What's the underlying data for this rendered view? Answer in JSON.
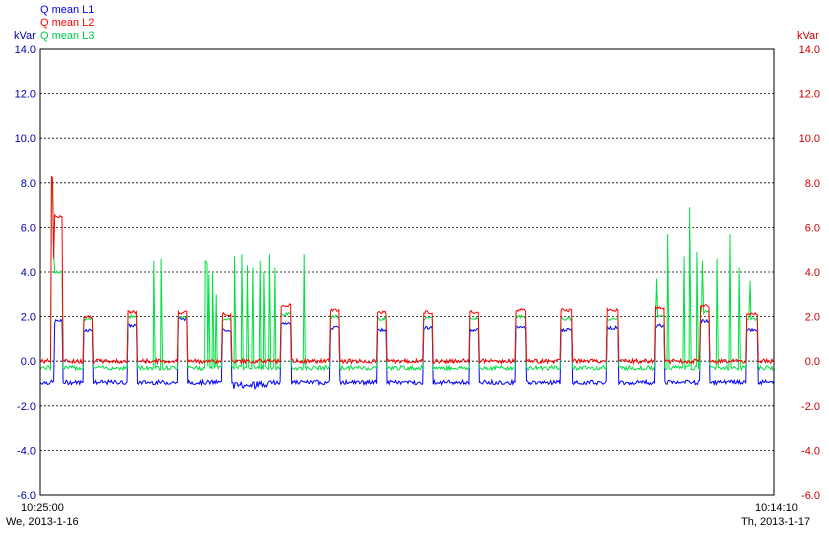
{
  "chart_data": {
    "type": "line",
    "legend": [
      {
        "name": "Q mean L1",
        "color": "#0000ff"
      },
      {
        "name": "Q mean L2",
        "color": "#ff0000"
      },
      {
        "name": "Q mean L3",
        "color": "#00e040"
      }
    ],
    "y_unit_left": "kVar",
    "y_unit_right": "kVar",
    "ylim": [
      -6.0,
      14.0
    ],
    "y_ticks": [
      "14.0",
      "12.0",
      "10.0",
      "8.0",
      "6.0",
      "4.0",
      "2.0",
      "0.0",
      "-2.0",
      "-4.0",
      "-6.0"
    ],
    "grid": "horizontal dashed",
    "x_start": {
      "time": "10:25:00",
      "date": "We, 2013-1-16"
    },
    "x_end": {
      "time": "10:14:10",
      "date": "Th, 2013-1-17"
    },
    "series_profile": {
      "L1": {
        "base": -0.95,
        "high": 1.4
      },
      "L2": {
        "base": 0.0,
        "high": 2.1
      },
      "L3": {
        "base": -0.3,
        "high": 1.9
      }
    },
    "pulses": [
      {
        "start": 0.04,
        "end": 0.06,
        "L1": 1.8,
        "L2": 6.5,
        "L3": 4.0
      },
      {
        "start": 0.12,
        "end": 0.145,
        "L1": 1.4,
        "L2": 2.0,
        "L3": 1.9
      },
      {
        "start": 0.24,
        "end": 0.265,
        "L1": 1.6,
        "L2": 2.2,
        "L3": 2.0
      },
      {
        "start": 0.375,
        "end": 0.4,
        "L1": 1.9,
        "L2": 2.2,
        "L3": 2.0
      },
      {
        "start": 0.495,
        "end": 0.52,
        "L1": 1.4,
        "L2": 2.1,
        "L3": 1.9
      },
      {
        "start": 0.655,
        "end": 0.685,
        "L1": 1.7,
        "L2": 2.5,
        "L3": 2.1
      },
      {
        "start": 0.79,
        "end": 0.815,
        "L1": 1.5,
        "L2": 2.3,
        "L3": 2.0
      },
      {
        "start": 0.92,
        "end": 0.945,
        "L1": 1.4,
        "L2": 2.2,
        "L3": 1.9
      },
      {
        "start": 1.045,
        "end": 1.07,
        "L1": 1.5,
        "L2": 2.2,
        "L3": 1.9
      },
      {
        "start": 1.17,
        "end": 1.195,
        "L1": 1.4,
        "L2": 2.2,
        "L3": 1.9
      },
      {
        "start": 1.295,
        "end": 1.325,
        "L1": 1.5,
        "L2": 2.3,
        "L3": 2.0
      },
      {
        "start": 1.42,
        "end": 1.45,
        "L1": 1.4,
        "L2": 2.3,
        "L3": 1.9
      },
      {
        "start": 1.545,
        "end": 1.575,
        "L1": 1.5,
        "L2": 2.3,
        "L3": 1.9
      },
      {
        "start": 1.675,
        "end": 1.7,
        "L1": 1.6,
        "L2": 2.4,
        "L3": 2.0
      },
      {
        "start": 1.8,
        "end": 1.825,
        "L1": 1.8,
        "L2": 2.5,
        "L3": 2.2
      },
      {
        "start": 1.925,
        "end": 1.955,
        "L1": 1.4,
        "L2": 2.1,
        "L3": 1.9
      }
    ],
    "spikes": [
      {
        "x": 0.03,
        "L3": 4.2,
        "L2": 4.4
      },
      {
        "x": 0.031,
        "L3": 8.0,
        "L2": 8.3
      },
      {
        "x": 0.034,
        "L3": 8.1,
        "L2": 8.2
      },
      {
        "x": 0.037,
        "L3": 4.8,
        "L2": 4.6
      },
      {
        "x": 0.31,
        "L3": 4.5
      },
      {
        "x": 0.33,
        "L3": 4.6
      },
      {
        "x": 0.45,
        "L3": 4.5
      },
      {
        "x": 0.455,
        "L3": 4.4
      },
      {
        "x": 0.46,
        "L3": 3.9
      },
      {
        "x": 0.47,
        "L3": 4.0
      },
      {
        "x": 0.48,
        "L3": 3.0
      },
      {
        "x": 0.53,
        "L3": 4.7
      },
      {
        "x": 0.55,
        "L3": 4.8
      },
      {
        "x": 0.565,
        "L3": 4.3
      },
      {
        "x": 0.58,
        "L3": 4.2
      },
      {
        "x": 0.6,
        "L3": 4.5
      },
      {
        "x": 0.61,
        "L3": 4.0
      },
      {
        "x": 0.625,
        "L3": 4.8
      },
      {
        "x": 0.64,
        "L3": 4.2
      },
      {
        "x": 0.72,
        "L3": 4.8
      },
      {
        "x": 1.71,
        "L3": 5.7
      },
      {
        "x": 1.68,
        "L3": 3.7
      },
      {
        "x": 1.755,
        "L3": 4.7
      },
      {
        "x": 1.77,
        "L3": 6.9
      },
      {
        "x": 1.79,
        "L3": 4.9
      },
      {
        "x": 1.805,
        "L3": 4.5
      },
      {
        "x": 1.845,
        "L3": 4.6
      },
      {
        "x": 1.88,
        "L3": 5.7
      },
      {
        "x": 1.905,
        "L3": 4.2
      },
      {
        "x": 1.935,
        "L3": 3.6
      }
    ]
  }
}
